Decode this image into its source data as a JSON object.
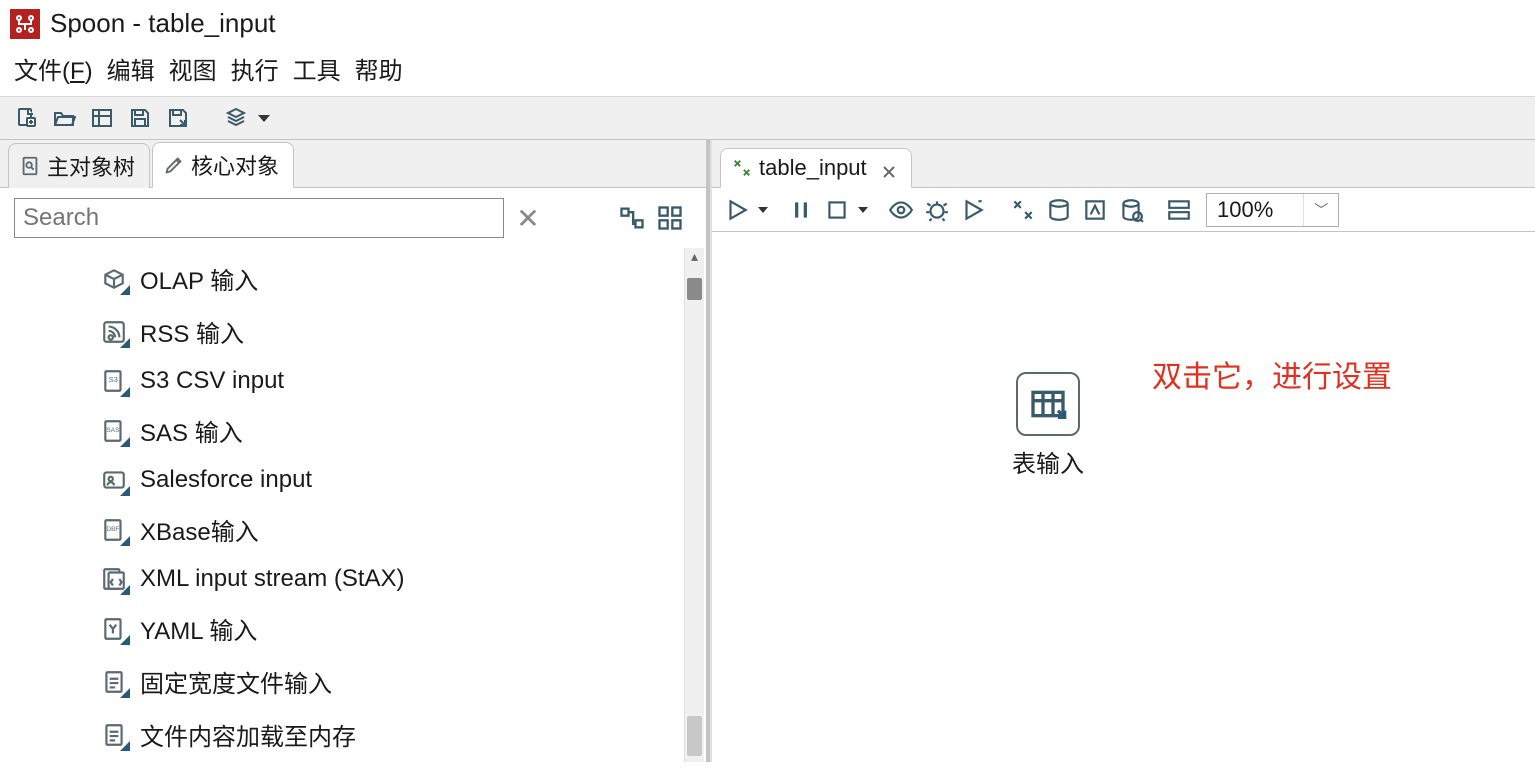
{
  "window": {
    "title": "Spoon - table_input"
  },
  "menu": {
    "file": "文件(F)",
    "edit": "编辑",
    "view": "视图",
    "run": "执行",
    "tools": "工具",
    "help": "帮助"
  },
  "leftTabs": {
    "mainTree": "主对象树",
    "coreObjects": "核心对象"
  },
  "search": {
    "placeholder": "Search"
  },
  "treeItems": [
    {
      "icon": "cube",
      "label": "OLAP 输入"
    },
    {
      "icon": "rss",
      "label": "RSS 输入"
    },
    {
      "icon": "s3",
      "label": "S3 CSV input"
    },
    {
      "icon": "sas",
      "label": "SAS 输入"
    },
    {
      "icon": "sf",
      "label": "Salesforce input"
    },
    {
      "icon": "dbf",
      "label": "XBase输入"
    },
    {
      "icon": "xml",
      "label": "XML input stream (StAX)"
    },
    {
      "icon": "yaml",
      "label": "YAML 输入"
    },
    {
      "icon": "file",
      "label": "固定宽度文件输入"
    },
    {
      "icon": "file",
      "label": "文件内容加载至内存"
    }
  ],
  "editorTab": {
    "name": "table_input"
  },
  "zoom": {
    "value": "100%"
  },
  "canvas": {
    "step_label": "表输入",
    "annotation": "双击它，进行设置"
  }
}
